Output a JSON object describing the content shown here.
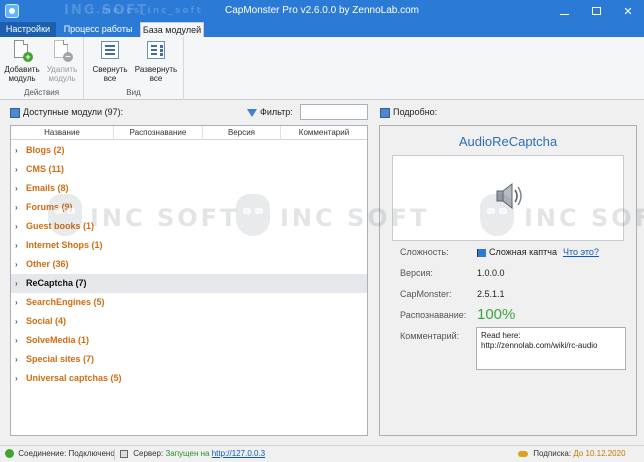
{
  "window": {
    "title": "CapMonster Pro v2.6.0.0 by ZennoLab.com",
    "watermark_top": "INC SOFT",
    "watermark_link": "t.me/cs_inc_soft"
  },
  "ribbon": {
    "tabs": [
      {
        "label": "Настройки"
      },
      {
        "label": "Процесс работы"
      },
      {
        "label": "База модулей"
      }
    ],
    "groups": {
      "actions": {
        "label": "Действия",
        "add": "Добавить\nмодуль",
        "remove": "Удалить\nмодуль"
      },
      "view": {
        "label": "Вид",
        "collapse": "Свернуть\nвсе",
        "expand": "Развернуть\nвсе"
      }
    }
  },
  "modules_panel": {
    "title": "Доступные модули (97):",
    "filter_label": "Фильтр:",
    "filter_value": "",
    "columns": [
      "Название",
      "Распознавание",
      "Версия",
      "Комментарий"
    ],
    "groups": [
      {
        "label": "Blogs (2)"
      },
      {
        "label": "CMS (11)"
      },
      {
        "label": "Emails (8)"
      },
      {
        "label": "Forums (9)"
      },
      {
        "label": "Guest books (1)"
      },
      {
        "label": "Internet Shops (1)"
      },
      {
        "label": "Other (36)"
      },
      {
        "label": "ReCaptcha (7)"
      },
      {
        "label": "SearchEngines (5)"
      },
      {
        "label": "Social (4)"
      },
      {
        "label": "SolveMedia (1)"
      },
      {
        "label": "Special sites (7)"
      },
      {
        "label": "Universal captchas (5)"
      }
    ],
    "selected_index": 7
  },
  "details": {
    "header": "Подробно:",
    "module_name": "AudioReCaptcha",
    "preview_icon": "speaker-icon",
    "complexity_label": "Сложность:",
    "complexity_value": "Сложная каптча",
    "complexity_help": "Что это?",
    "version_label": "Версия:",
    "version_value": "1.0.0.0",
    "capmonster_label": "CapMonster:",
    "capmonster_value": "2.5.1.1",
    "recognition_label": "Распознавание:",
    "recognition_value": "100%",
    "comment_label": "Комментарий:",
    "comment_value": "Read here:\nhttp://zennolab.com/wiki/rc-audio",
    "colors": {
      "title": "#2d6fb4",
      "percent": "#3ea33e"
    }
  },
  "status": {
    "connection_label": "Соединение:",
    "connection_value": "Подключено",
    "server_label": "Сервер:",
    "server_value": "Запущен на",
    "server_link": "http://127.0.0.3",
    "subscription_label": "Подписка:",
    "subscription_value": "До 10.12.2020"
  },
  "watermark": "INC SOFT",
  "colors": {
    "titlebar": "#2b7bd6",
    "module_group": "#cf6d12"
  }
}
